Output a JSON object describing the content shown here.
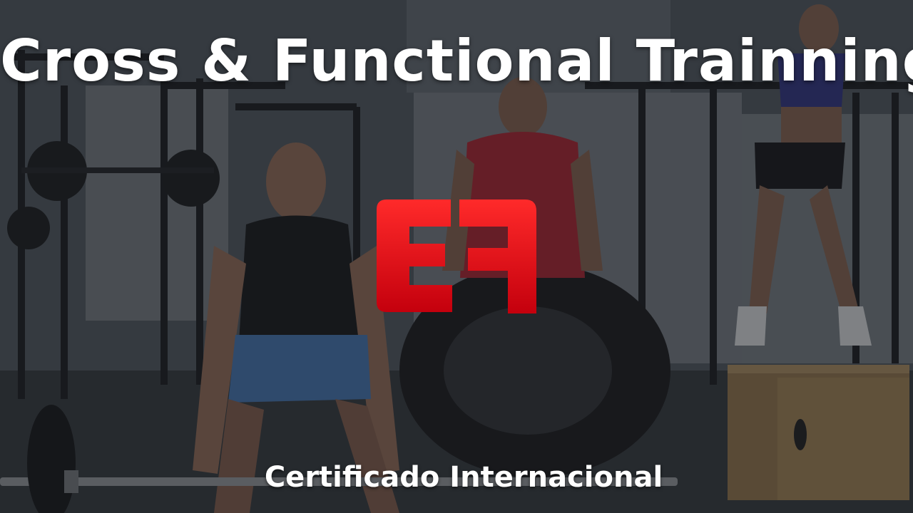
{
  "banner": {
    "title": "Cross & Functional Trainning",
    "subtitle": "Certificado Internacional"
  },
  "logo": {
    "text": "EF",
    "color": "#e00010"
  },
  "background": {
    "scene": "gym-photo",
    "overlay_color": "#1c1f24"
  }
}
